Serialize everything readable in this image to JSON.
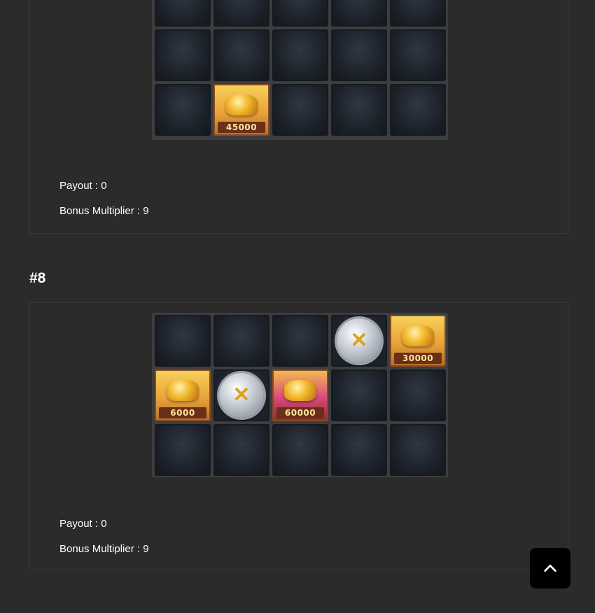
{
  "entries": [
    {
      "heading": "",
      "payout_text": "Payout : 0",
      "bonus_text": "Bonus Multiplier : 9",
      "grid": [
        [
          "skull",
          "skull",
          "skull",
          "skull",
          "skull"
        ],
        [
          "skull",
          "skull",
          "skull",
          "skull",
          "skull"
        ],
        [
          "skull",
          "prize",
          "skull",
          "skull",
          "skull"
        ]
      ],
      "prize_values": [
        "45000"
      ]
    },
    {
      "heading": "#8",
      "payout_text": "Payout : 0",
      "bonus_text": "Bonus Multiplier : 9",
      "grid": [
        [
          "skull",
          "skull",
          "skull",
          "coin",
          "prize"
        ],
        [
          "prize",
          "coin",
          "prize",
          "skull",
          "skull"
        ],
        [
          "skull",
          "skull",
          "skull",
          "skull",
          "skull"
        ]
      ],
      "prize_values": [
        "30000",
        "6000",
        "60000"
      ]
    }
  ],
  "icons": {
    "back_to_top": "chevron-up-icon",
    "empty_tile": "skull-flag-icon",
    "coin_tile": "skull-coin-icon",
    "prize_tile": "gold-treasure-icon"
  },
  "colors": {
    "page_background": "#2b2b2b",
    "card_border": "#3a3a3a",
    "text": "#ffffff",
    "back_to_top_background": "#000000"
  }
}
